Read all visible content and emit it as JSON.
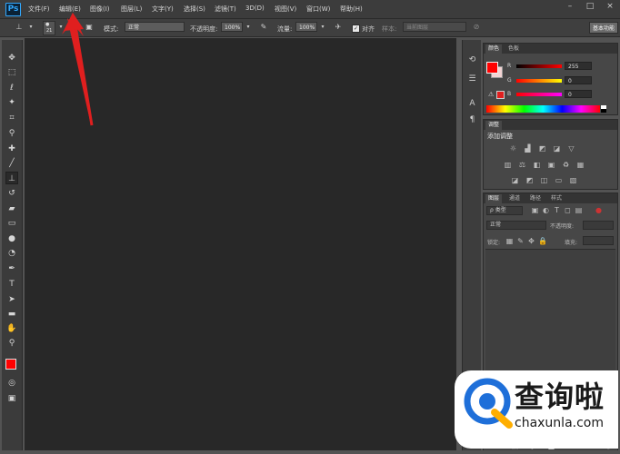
{
  "app": {
    "logo": "Ps"
  },
  "menu": [
    "文件(F)",
    "编辑(E)",
    "图像(I)",
    "图层(L)",
    "文字(Y)",
    "选择(S)",
    "滤镜(T)",
    "3D(D)",
    "视图(V)",
    "窗口(W)",
    "帮助(H)"
  ],
  "window_controls": {
    "minimize": "–",
    "restore": "□",
    "close": "×"
  },
  "options": {
    "brush_size": "21",
    "mode_label": "模式:",
    "mode_value": "正常",
    "opacity_label": "不透明度:",
    "opacity_value": "100%",
    "flow_label": "流量:",
    "flow_value": "100%",
    "aligned_label": "对齐",
    "sample_label": "样本:",
    "sample_value": "当前图层",
    "workspace": "基本功能"
  },
  "color_panel": {
    "tabs": [
      "颜色",
      "色板"
    ],
    "channels": [
      {
        "label": "R",
        "value": "255"
      },
      {
        "label": "G",
        "value": "0"
      },
      {
        "label": "B",
        "value": "0"
      }
    ],
    "foreground_color": "#ff0000"
  },
  "adjust_panel": {
    "tab": "调整",
    "title": "添加调整"
  },
  "layers_panel": {
    "tabs": [
      "图层",
      "通道",
      "路径",
      "样式"
    ],
    "filter_label": "ρ 类型",
    "blend_mode": "正常",
    "opacity_label": "不透明度:",
    "lock_label": "锁定:",
    "fill_label": "填充:"
  },
  "watermark": {
    "brand": "查询啦",
    "domain": "chaxunla.com"
  },
  "colors": {
    "canvas": "#282828",
    "accent_red": "#e01f1f",
    "brand_blue": "#1e6fd9"
  }
}
